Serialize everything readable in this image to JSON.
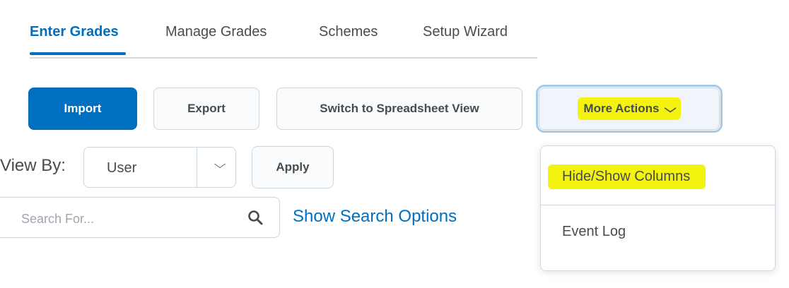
{
  "tabs": [
    {
      "label": "Enter Grades",
      "active": true
    },
    {
      "label": "Manage Grades",
      "active": false
    },
    {
      "label": "Schemes",
      "active": false
    },
    {
      "label": "Setup Wizard",
      "active": false
    }
  ],
  "toolbar": {
    "import_label": "Import",
    "export_label": "Export",
    "spreadsheet_label": "Switch to Spreadsheet View",
    "more_actions_label": "More Actions"
  },
  "view_by": {
    "label": "View By:",
    "selected": "User",
    "apply_label": "Apply"
  },
  "search": {
    "placeholder": "Search For...",
    "value": "",
    "options_link": "Show Search Options"
  },
  "more_actions_menu": {
    "items": [
      {
        "label": "Hide/Show Columns",
        "highlighted": true
      },
      {
        "label": "Event Log",
        "highlighted": false
      }
    ]
  },
  "colors": {
    "accent": "#006fbf",
    "highlight": "#f3f30f",
    "text": "#494c4e",
    "border": "#cdd5dc"
  },
  "icons": [
    "chevron-down-icon",
    "search-icon"
  ]
}
